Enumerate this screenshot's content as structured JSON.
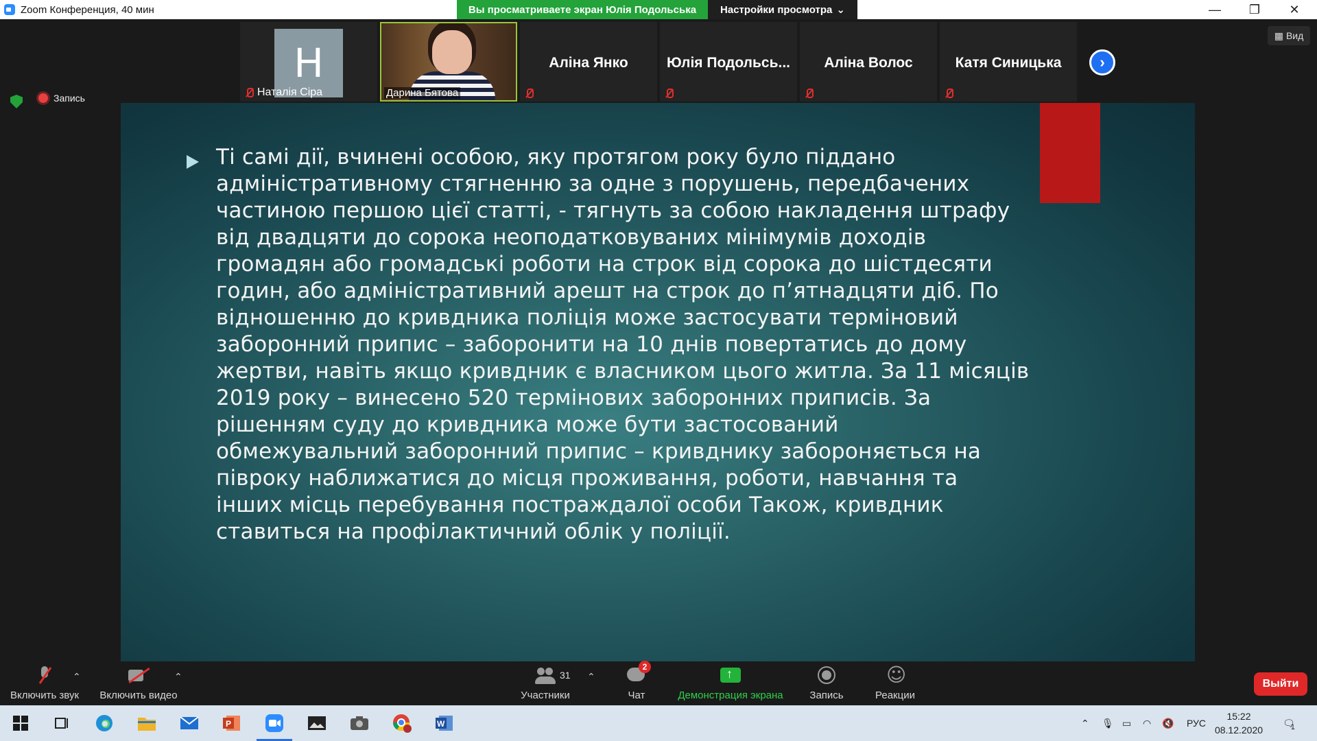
{
  "window": {
    "title": "Zoom Конференция, 40 мин",
    "viewing_banner": "Вы просматриваете экран Юлія Подольська",
    "view_options": "Настройки просмотра",
    "minimize": "—",
    "restore": "❐",
    "close": "✕"
  },
  "participants": [
    {
      "name": "Наталія Сіра",
      "avatar_letter": "H",
      "muted": true
    },
    {
      "name": "Дарина Бятова",
      "video": true,
      "muted": true
    },
    {
      "name": "Аліна Янко",
      "muted": true
    },
    {
      "name": "Юлія Подольсь...",
      "muted": true
    },
    {
      "name": "Аліна Волос",
      "muted": true
    },
    {
      "name": "Катя Синицька",
      "muted": false
    }
  ],
  "view_button": "Вид",
  "recording_label": "Запись",
  "slide": {
    "lines": [
      "Ті самі дії, вчинені особою, яку протягом року було піддано",
      "адміністративному стягненню за одне з порушень, передбачених",
      "частиною першою цієї статті, - тягнуть за собою накладення штрафу",
      "від двадцяти до сорока неоподатковуваних мінімумів доходів",
      "громадян або громадські роботи на строк від сорока до шістдесяти",
      "годин, або адміністративний арешт на строк до п’ятнадцяти діб. По",
      "відношенню до кривдника поліція може застосувати терміновий",
      "заборонний припис – заборонити на 10 днів повертатись до дому",
      "жертви, навіть якщо кривдник є власником цього житла. За 11 місяців",
      "2019 року – винесено 520 термінових заборонних приписів. За",
      "рішенням суду до кривдника може бути застосований",
      "обмежувальний заборонний припис – кривднику забороняється на",
      "півроку наближатися до місця проживання, роботи, навчання та",
      "інших місць перебування постраждалої особи Також, кривдник",
      "ставиться на профілактичний облік у поліції."
    ]
  },
  "toolbar": {
    "unmute": "Включить звук",
    "start_video": "Включить видео",
    "participants": "Участники",
    "participants_count": "31",
    "chat": "Чат",
    "chat_badge": "2",
    "share_screen": "Демонстрация экрана",
    "record": "Запись",
    "reactions": "Реакции",
    "leave": "Выйти"
  },
  "taskbar": {
    "language": "РУС",
    "time": "15:22",
    "date": "08.12.2020",
    "notifications": "1"
  },
  "colors": {
    "accent_green": "#23a33a",
    "leave_red": "#e02828",
    "slide_teal": "#2a6468",
    "slide_red_tab": "#b81818"
  }
}
